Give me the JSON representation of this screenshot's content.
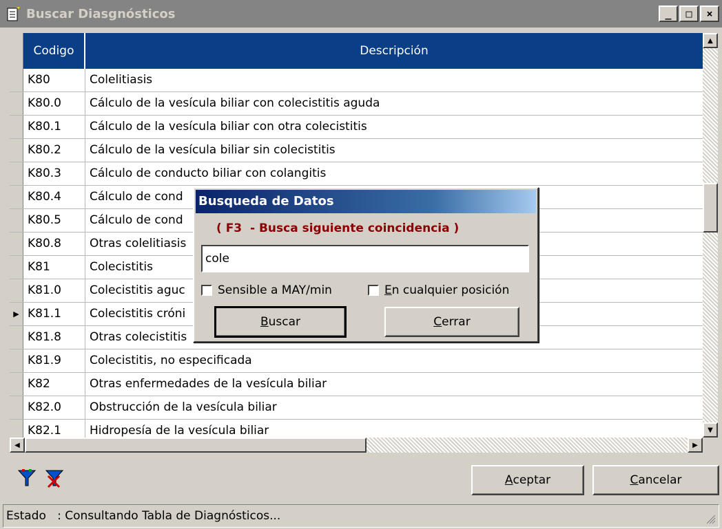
{
  "window": {
    "title": "Buscar Diasgnósticos",
    "controls": [
      "_",
      "□",
      "×"
    ]
  },
  "grid": {
    "columns": [
      "Codigo",
      "Descripción"
    ],
    "rows": [
      {
        "code": "K80",
        "desc": "Colelitiasis"
      },
      {
        "code": "K80.0",
        "desc": "Cálculo de la vesícula biliar con colecistitis aguda"
      },
      {
        "code": "K80.1",
        "desc": "Cálculo de la vesícula biliar con otra colecistitis"
      },
      {
        "code": "K80.2",
        "desc": "Cálculo de la vesícula biliar sin colecistitis"
      },
      {
        "code": "K80.3",
        "desc": "Cálculo de conducto biliar con colangitis"
      },
      {
        "code": "K80.4",
        "desc": "Cálculo de cond"
      },
      {
        "code": "K80.5",
        "desc": "Cálculo de cond"
      },
      {
        "code": "K80.8",
        "desc": "Otras colelitiasis"
      },
      {
        "code": "K81",
        "desc": "Colecistitis"
      },
      {
        "code": "K81.0",
        "desc": "Colecistitis aguc"
      },
      {
        "code": "K81.1",
        "desc": "Colecistitis cróni"
      },
      {
        "code": "K81.8",
        "desc": "Otras colecistitis"
      },
      {
        "code": "K81.9",
        "desc": "Colecistitis, no especificada"
      },
      {
        "code": "K82",
        "desc": "Otras enfermedades de la vesícula biliar"
      },
      {
        "code": "K82.0",
        "desc": "Obstrucción de la vesícula biliar"
      },
      {
        "code": "K82.1",
        "desc": "Hidropesía de la vesícula biliar"
      }
    ],
    "current_row_marker": "▶"
  },
  "dialog": {
    "title": "Busqueda de Datos",
    "hint": "( F3  - Busca siguiente coincidencia )",
    "search_value": "cole",
    "case_sensitive_label": "Sensible a MAY/min",
    "any_position_label": "En cualquier posición",
    "search_button": {
      "hotkey": "B",
      "rest": "uscar"
    },
    "close_button": {
      "hotkey": "C",
      "rest": "errar"
    }
  },
  "footer": {
    "accept_button": {
      "hotkey": "A",
      "rest": "ceptar"
    },
    "cancel_button": {
      "hotkey": "C",
      "rest": "ancelar"
    },
    "icons": [
      "filter-icon",
      "clear-filter-icon"
    ]
  },
  "status": {
    "text": "Estado   : Consultando Tabla de Diagnósticos..."
  },
  "colors": {
    "header_bg": "#0a3e86",
    "dialog_title": "#0a246a",
    "hint": "#8b0000"
  }
}
